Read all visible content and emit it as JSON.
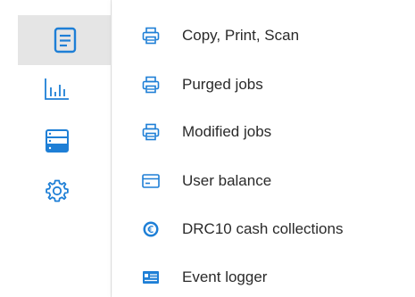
{
  "colors": {
    "accent": "#1e7fd6",
    "rail_active_bg": "#e5e5e5",
    "text": "#2a2a2a"
  },
  "rail": {
    "items": [
      {
        "icon": "document-icon",
        "active": true
      },
      {
        "icon": "bar-chart-icon",
        "active": false
      },
      {
        "icon": "server-icon",
        "active": false
      },
      {
        "icon": "settings-gear-icon",
        "active": false
      }
    ]
  },
  "menu": {
    "items": [
      {
        "label": "Copy, Print, Scan",
        "icon": "printer-icon"
      },
      {
        "label": "Purged jobs",
        "icon": "printer-icon"
      },
      {
        "label": "Modified jobs",
        "icon": "printer-icon"
      },
      {
        "label": "User balance",
        "icon": "card-icon"
      },
      {
        "label": "DRC10 cash collections",
        "icon": "euro-coin-icon"
      },
      {
        "label": "Event logger",
        "icon": "log-icon"
      }
    ]
  }
}
